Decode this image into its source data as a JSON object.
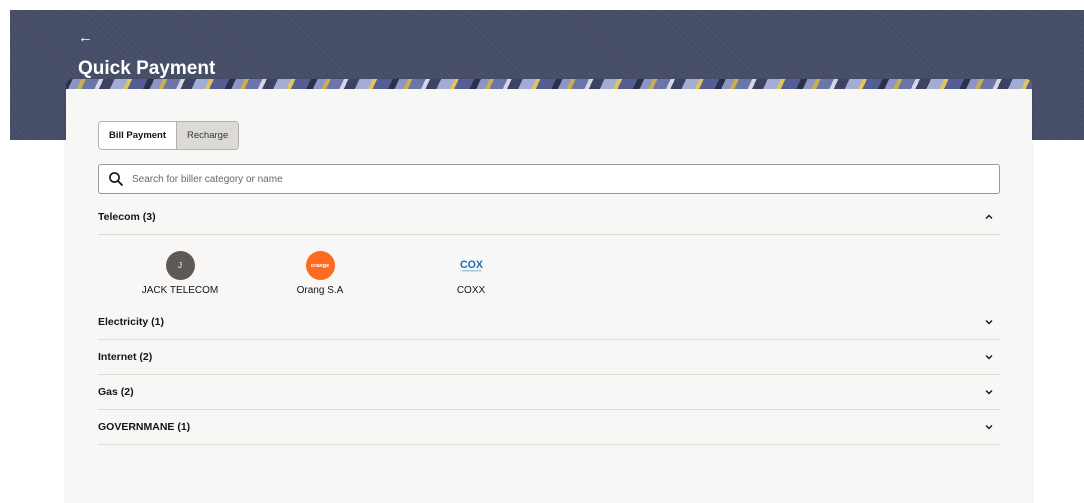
{
  "header": {
    "back_icon": "back-arrow-icon",
    "back_glyph": "←",
    "title": "Quick Payment",
    "banner_color": "#464d67"
  },
  "tabs": [
    {
      "label": "Bill Payment",
      "active": true
    },
    {
      "label": "Recharge",
      "active": false
    }
  ],
  "search": {
    "placeholder": "Search for biller category or name",
    "value": "",
    "icon": "search-icon"
  },
  "categories": [
    {
      "label": "Telecom (3)",
      "expanded": true,
      "chevron": "chevron-up-icon"
    },
    {
      "label": "Electricity (1)",
      "expanded": false,
      "chevron": "chevron-down-icon"
    },
    {
      "label": "Internet (2)",
      "expanded": false,
      "chevron": "chevron-down-icon"
    },
    {
      "label": "Gas (2)",
      "expanded": false,
      "chevron": "chevron-down-icon"
    },
    {
      "label": "GOVERNMANE (1)",
      "expanded": false,
      "chevron": "chevron-down-icon"
    }
  ],
  "telecom_billers": [
    {
      "name": "JACK TELECOM",
      "logo_text": "J",
      "logo_color": "#5e5955"
    },
    {
      "name": "Orang  S.A",
      "logo_text": "orange",
      "logo_color": "#ff6a21"
    },
    {
      "name": "COXX",
      "logo_text": "COX",
      "logo_color": "#1b6fb3"
    }
  ]
}
